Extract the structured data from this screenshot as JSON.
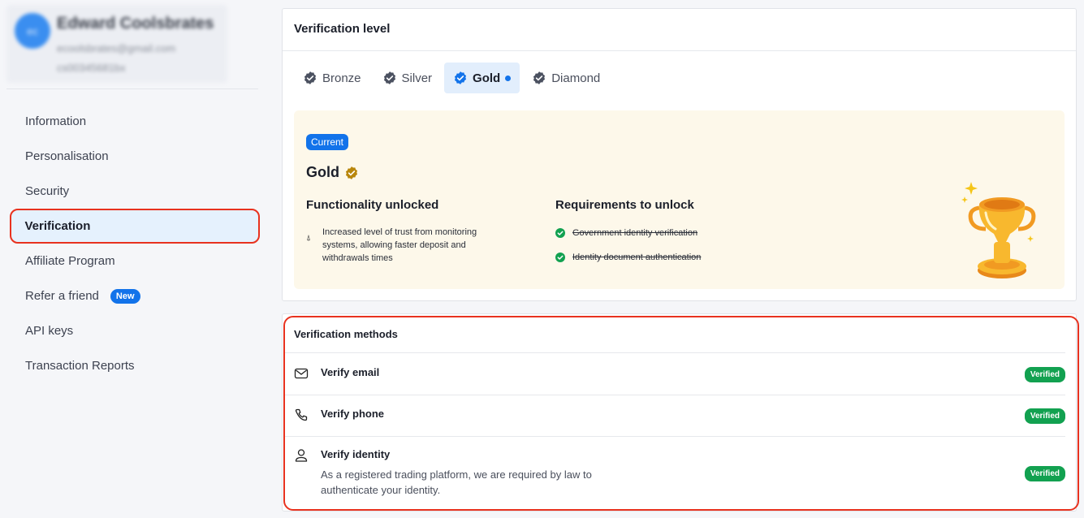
{
  "profile": {
    "avatar_initials": "ec",
    "name": "Edward Coolsbrates",
    "email": "ecoolsbrates@gmail.com",
    "user_id": "cs00345681bx"
  },
  "sidebar": {
    "items": [
      {
        "label": "Information"
      },
      {
        "label": "Personalisation"
      },
      {
        "label": "Security"
      },
      {
        "label": "Verification",
        "active": true
      },
      {
        "label": "Affiliate Program"
      },
      {
        "label": "Refer a friend",
        "badge": "New"
      },
      {
        "label": "API keys"
      },
      {
        "label": "Transaction Reports"
      }
    ]
  },
  "verification_level": {
    "title": "Verification level",
    "tabs": [
      {
        "label": "Bronze"
      },
      {
        "label": "Silver"
      },
      {
        "label": "Gold",
        "active": true
      },
      {
        "label": "Diamond"
      }
    ],
    "card": {
      "current_label": "Current",
      "level_name": "Gold",
      "functionality_title": "Functionality unlocked",
      "functionality_items": [
        "Increased level of trust from monitoring systems, allowing faster deposit and withdrawals times"
      ],
      "requirements_title": "Requirements to unlock",
      "requirements": [
        "Government identity verification",
        "Identity document authentication"
      ]
    }
  },
  "verification_methods": {
    "title": "Verification methods",
    "items": [
      {
        "icon": "mail-icon",
        "label": "Verify email",
        "status": "Verified"
      },
      {
        "icon": "phone-icon",
        "label": "Verify phone",
        "status": "Verified"
      },
      {
        "icon": "user-icon",
        "label": "Verify identity",
        "description": "As a registered trading platform, we are required by law to authenticate your identity.",
        "status": "Verified"
      }
    ]
  },
  "colors": {
    "accent": "#1273ea",
    "verified_green": "#12a150",
    "highlight_red": "#e8321f",
    "gold": "#b8860b",
    "card_bg": "#fdf8ea"
  }
}
